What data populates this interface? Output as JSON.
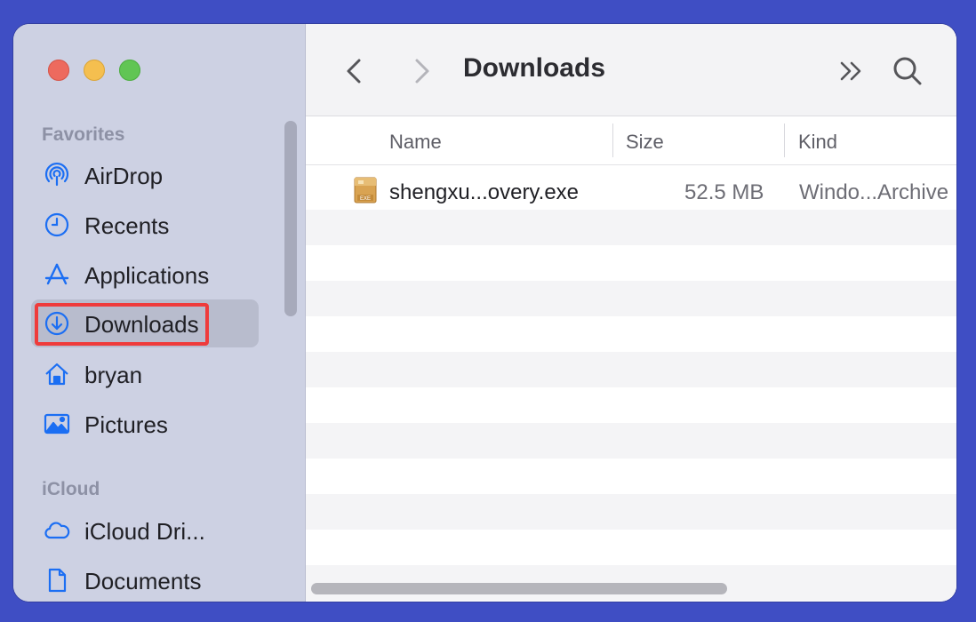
{
  "window": {
    "title": "Downloads"
  },
  "sidebar": {
    "sections": [
      {
        "label": "Favorites"
      },
      {
        "label": "iCloud"
      }
    ],
    "items": [
      {
        "label": "AirDrop",
        "icon": "airdrop-icon"
      },
      {
        "label": "Recents",
        "icon": "clock-icon"
      },
      {
        "label": "Applications",
        "icon": "applications-icon"
      },
      {
        "label": "Downloads",
        "icon": "download-circle-icon",
        "selected": true
      },
      {
        "label": "bryan",
        "icon": "home-icon"
      },
      {
        "label": "Pictures",
        "icon": "photo-icon"
      },
      {
        "label": "iCloud Dri...",
        "icon": "cloud-icon"
      },
      {
        "label": "Documents",
        "icon": "document-icon"
      }
    ]
  },
  "columns": {
    "name": "Name",
    "size": "Size",
    "kind": "Kind"
  },
  "files": [
    {
      "name": "shengxu...overy.exe",
      "size": "52.5 MB",
      "kind": "Windo...Archive",
      "icon": "exe-archive-icon",
      "icon_text": "EXE"
    }
  ],
  "colors": {
    "accent": "#1b6ef3",
    "highlight": "#ef3b3b",
    "desktop": "#3f4ec4"
  }
}
